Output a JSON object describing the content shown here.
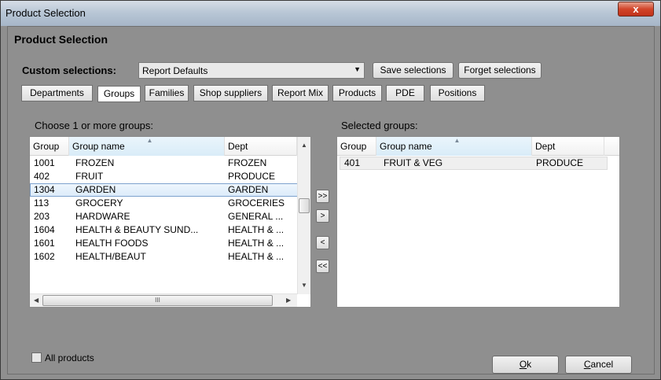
{
  "window": {
    "title": "Product Selection",
    "close_glyph": "x"
  },
  "panel": {
    "title": "Product Selection"
  },
  "custom": {
    "label": "Custom selections:",
    "selected": "Report Defaults",
    "save_label": "Save selections",
    "forget_label": "Forget selections"
  },
  "tabs": [
    {
      "label": "Departments"
    },
    {
      "label": "Groups"
    },
    {
      "label": "Families"
    },
    {
      "label": "Shop suppliers"
    },
    {
      "label": "Report Mix"
    },
    {
      "label": "Products"
    },
    {
      "label": "PDE"
    },
    {
      "label": "Positions"
    }
  ],
  "available": {
    "label": "Choose 1 or more groups:",
    "columns": [
      "Group",
      "Group name",
      "Dept"
    ],
    "rows": [
      {
        "group": "1001",
        "name": "FROZEN",
        "dept": "FROZEN"
      },
      {
        "group": "402",
        "name": "FRUIT",
        "dept": "PRODUCE"
      },
      {
        "group": "1304",
        "name": "GARDEN",
        "dept": "GARDEN"
      },
      {
        "group": "113",
        "name": "GROCERY",
        "dept": "GROCERIES"
      },
      {
        "group": "203",
        "name": "HARDWARE",
        "dept": "GENERAL ..."
      },
      {
        "group": "1604",
        "name": "HEALTH & BEAUTY SUND...",
        "dept": "HEALTH & ..."
      },
      {
        "group": "1601",
        "name": "HEALTH FOODS",
        "dept": "HEALTH & ..."
      },
      {
        "group": "1602",
        "name": "HEALTH/BEAUT",
        "dept": "HEALTH & ..."
      }
    ],
    "hscroll_grip": "III"
  },
  "move_buttons": {
    "add_all": ">>",
    "add": ">",
    "remove": "<",
    "remove_all": "<<"
  },
  "selected": {
    "label": "Selected groups:",
    "columns": [
      "Group",
      "Group name",
      "Dept"
    ],
    "rows": [
      {
        "group": "401",
        "name": "FRUIT & VEG",
        "dept": "PRODUCE"
      }
    ]
  },
  "all_products": {
    "label": "All products",
    "checked": false
  },
  "buttons": {
    "ok_accel": "O",
    "ok_rest": "k",
    "cancel_accel": "C",
    "cancel_rest": "ancel"
  }
}
